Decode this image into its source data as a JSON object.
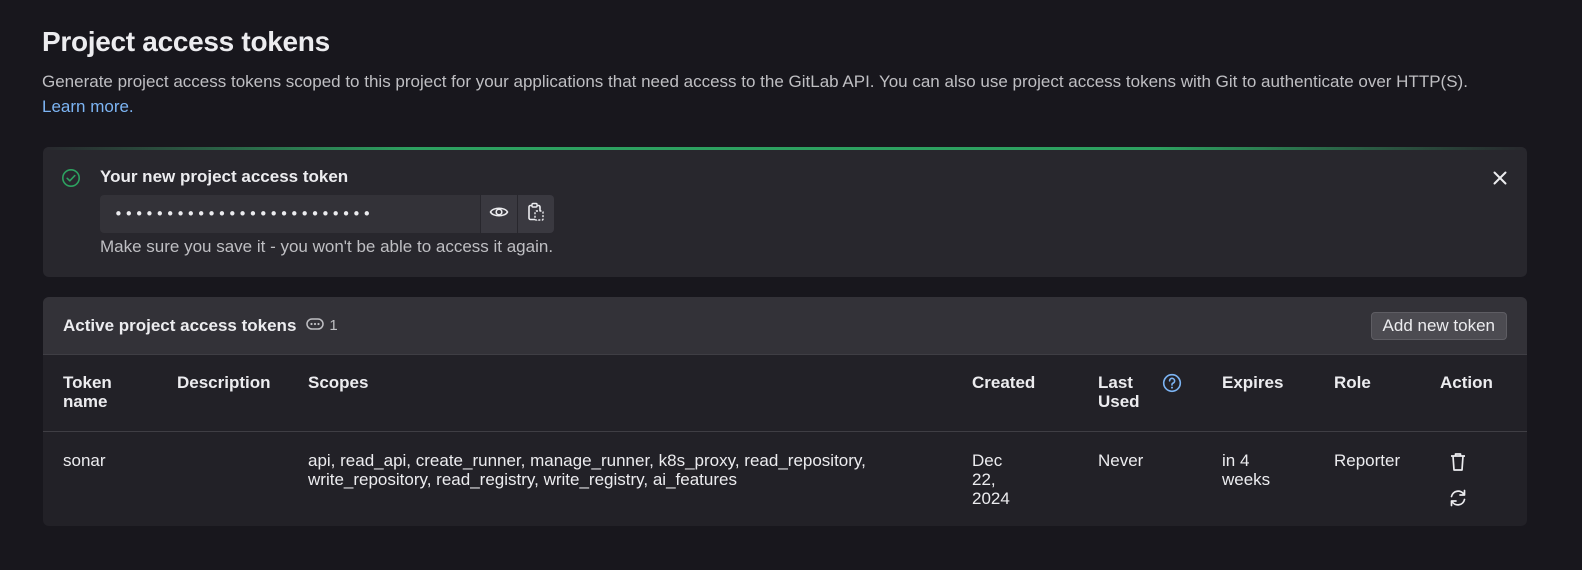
{
  "page": {
    "title": "Project access tokens",
    "description": "Generate project access tokens scoped to this project for your applications that need access to the GitLab API. You can also use project access tokens with Git to authenticate over HTTP(S).",
    "learn_more": "Learn more."
  },
  "alert": {
    "title": "Your new project access token",
    "token_value": "•••••••••••••••••••••••••",
    "help_text": "Make sure you save it - you won't be able to access it again.",
    "icons": [
      "check-circle-icon",
      "eye-icon",
      "clipboard-icon",
      "close-icon"
    ]
  },
  "tokens_card": {
    "title": "Active project access tokens",
    "count": "1",
    "add_button": "Add new token",
    "columns": [
      "Token name",
      "Description",
      "Scopes",
      "Created",
      "Last Used",
      "Expires",
      "Role",
      "Action"
    ],
    "rows": [
      {
        "name": "sonar",
        "description": "",
        "scopes": "api, read_api, create_runner, manage_runner, k8s_proxy, read_repository, write_repository, read_registry, write_registry, ai_features",
        "created": "Dec 22, 2024",
        "last_used": "Never",
        "expires": "in 4 weeks",
        "role": "Reporter"
      }
    ]
  },
  "colors": {
    "background": "#18171d",
    "panel": "#28272d",
    "success": "#2da160",
    "link": "#7cb4f3"
  }
}
